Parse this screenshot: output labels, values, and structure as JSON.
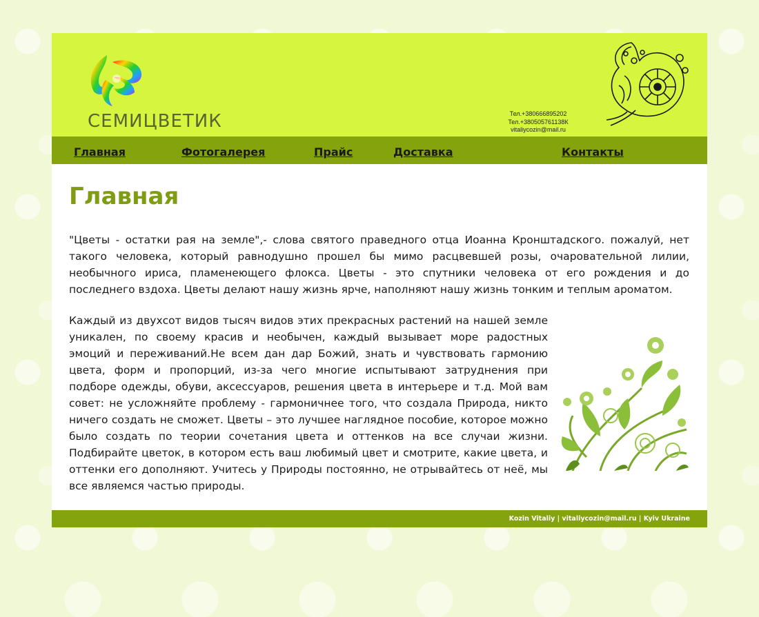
{
  "header": {
    "logo_text": "СЕМИЦВЕТИК",
    "phone1": "Тел.+380666895202",
    "phone2": "Тел.+380505761138К",
    "email": "vitaliycozin@mail.ru"
  },
  "nav": {
    "items": [
      {
        "label": "Главная"
      },
      {
        "label": "Фотогалерея"
      },
      {
        "label": "Прайс"
      },
      {
        "label": "Доставка"
      },
      {
        "label": "Контакты"
      }
    ]
  },
  "main": {
    "title": "Главная",
    "paragraph1": "\"Цветы - остатки рая на земле\",- слова святого праведного отца Иоанна Кронштадского. пожалуй, нет такого человека, который равнодушно прошел бы мимо расцвевшей розы, очаровательной лилии, необычного ириса, пламенеющего флокса. Цветы - это спутники человека от его рождения и до последнего вздоха. Цветы делают нашу жизнь ярче, наполняют нашу жизнь тонким и теплым ароматом.",
    "paragraph2": "Каждый из двухсот видов тысяч видов этих прекрасных растений на нашей земле уникален, по своему красив и необычен, каждый вызывает море радостных эмоций и переживаний.Не всем дан дар Божий, знать и чувствовать гармонию цвета, форм и пропорций, из-за чего многие испытывают затруднения при подборе одежды, обуви, аксессуаров, решения цвета в интерьере и т.д. Мой вам совет: не усложняйте проблему - гармоничнее того, что создала Природа, никто ничего создать не сможет. Цветы – это лучшее наглядное пособие, которое можно было создать по теории сочетания цвета и оттенков на все случаи жизни. Подбирайте цветок, в котором есть ваш любимый цвет и смотрите, какие цвета, и оттенки его дополняют. Учитесь у Природы постоянно, не отрывайтесь от неё, мы все являемся частью природы."
  },
  "footer": {
    "text": "Kozin Vitaliy | vitaliycozin@mail.ru | Kyiv Ukraine"
  },
  "colors": {
    "header_bg": "#d6f53f",
    "nav_bg": "#84a30d",
    "title_color": "#7f9c12",
    "page_bg": "#f1f8d6"
  }
}
